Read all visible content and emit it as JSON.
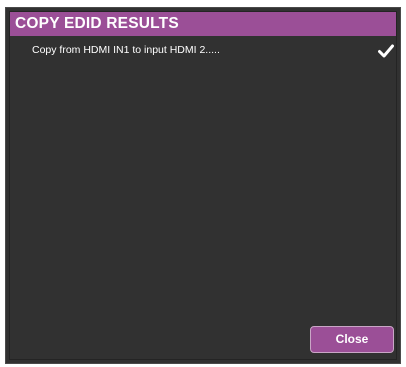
{
  "dialog": {
    "title": "COPY EDID RESULTS",
    "results": [
      {
        "text": "Copy from HDMI IN1 to input HDMI 2.....",
        "status_icon": "check-icon"
      }
    ],
    "close_label": "Close"
  },
  "colors": {
    "accent": "#9b4f97",
    "panel_background": "#313131",
    "text": "#ffffff"
  }
}
